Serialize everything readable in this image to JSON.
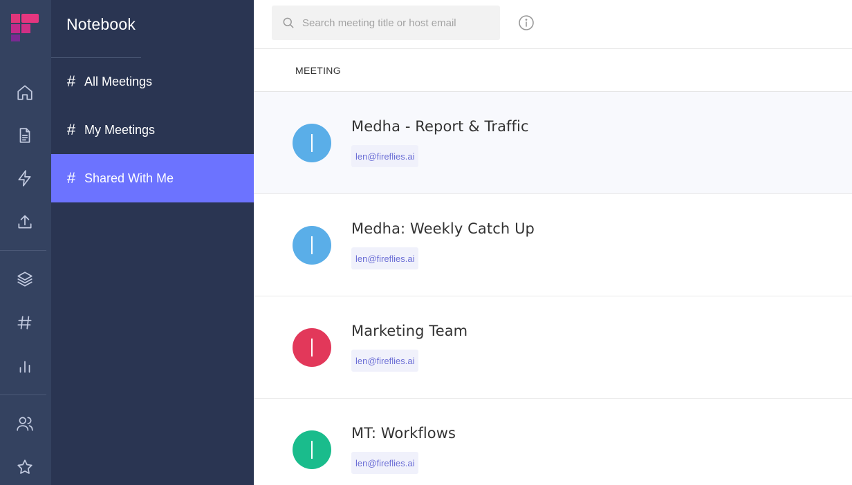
{
  "colors": {
    "rail_bg": "#344260",
    "nav_bg": "#2a3552",
    "accent": "#6c73ff",
    "avatar_blue": "#5aaee8",
    "avatar_red": "#e2385a",
    "avatar_green": "#1abc8c"
  },
  "rail": {
    "icons": [
      "logo-icon",
      "home-icon",
      "document-icon",
      "lightning-icon",
      "upload-icon",
      "layers-icon",
      "hashtag-icon",
      "bar-chart-icon",
      "users-icon",
      "star-icon"
    ]
  },
  "nav": {
    "title": "Notebook",
    "items": [
      {
        "label": "All Meetings",
        "icon": "#"
      },
      {
        "label": "My Meetings",
        "icon": "#"
      },
      {
        "label": "Shared With Me",
        "icon": "#",
        "active": true
      }
    ]
  },
  "search": {
    "placeholder": "Search meeting title or host email"
  },
  "table": {
    "header": "MEETING",
    "rows": [
      {
        "title": "Medha - Report & Traffic",
        "host": "len@fireflies.ai",
        "avatar_color": "#5aaee8"
      },
      {
        "title": "Medha: Weekly Catch Up",
        "host": "len@fireflies.ai",
        "avatar_color": "#5aaee8"
      },
      {
        "title": "Marketing Team",
        "host": "len@fireflies.ai",
        "avatar_color": "#e2385a"
      },
      {
        "title": "MT: Workflows",
        "host": "len@fireflies.ai",
        "avatar_color": "#1abc8c"
      }
    ]
  }
}
